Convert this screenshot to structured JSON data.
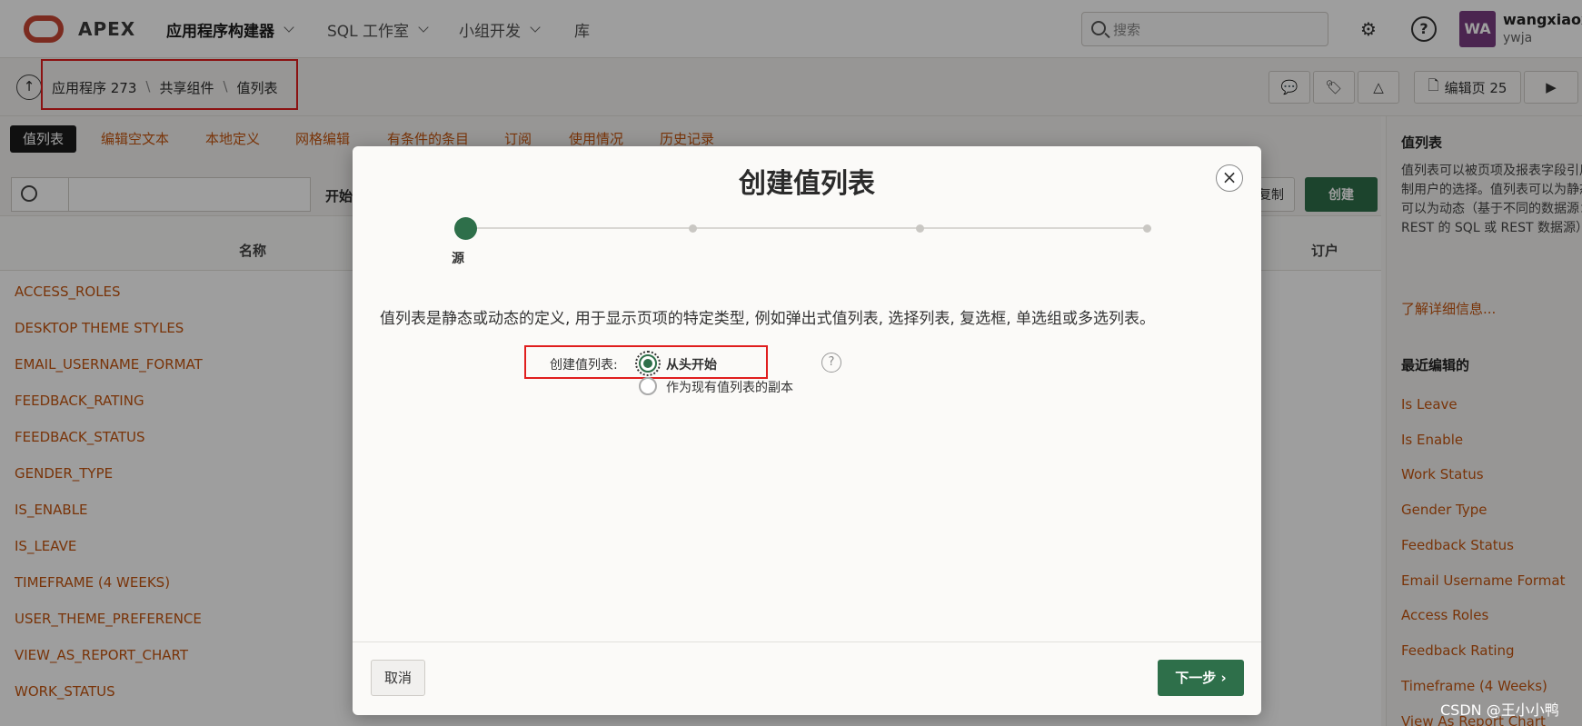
{
  "topbar": {
    "brand": "APEX",
    "nav": [
      "应用程序构建器",
      "SQL 工作室",
      "小组开发",
      "库"
    ],
    "search_placeholder": "搜索",
    "avatar_initials": "WA",
    "username": "wangxiaoxia",
    "workspace": "ywja"
  },
  "breadcrumb": {
    "items": [
      "应用程序 273",
      "共享组件",
      "值列表"
    ],
    "separator": "\\"
  },
  "toolbar": {
    "edit_page_label": "编辑页 25"
  },
  "tabs": [
    "值列表",
    "编辑空文本",
    "本地定义",
    "网格编辑",
    "有条件的条目",
    "订阅",
    "使用情况",
    "历史记录"
  ],
  "list": {
    "start_label": "开始",
    "copy_label": "复制",
    "create_label": "创建",
    "columns": [
      "名称",
      "订户"
    ],
    "rows": [
      "ACCESS_ROLES",
      "DESKTOP THEME STYLES",
      "EMAIL_USERNAME_FORMAT",
      "FEEDBACK_RATING",
      "FEEDBACK_STATUS",
      "GENDER_TYPE",
      "IS_ENABLE",
      "IS_LEAVE",
      "TIMEFRAME (4 WEEKS)",
      "USER_THEME_PREFERENCE",
      "VIEW_AS_REPORT_CHART",
      "WORK_STATUS"
    ]
  },
  "right_panel": {
    "title": "值列表",
    "description": "值列表可以被页项及报表字段引用。它控制显示的值并限制用户的选择。值列表可以为静态（基于您输入的值），也可以为动态（基于不同的数据源：本地数据库、启用 REST 的 SQL 或 REST 数据源）。",
    "learn_more": "了解详细信息...",
    "recent_title": "最近编辑的",
    "recent_items": [
      "Is Leave",
      "Is Enable",
      "Work Status",
      "Gender Type",
      "Feedback Status",
      "Email Username Format",
      "Access Roles",
      "Feedback Rating",
      "Timeframe (4 Weeks)",
      "View As Report Chart"
    ]
  },
  "dialog": {
    "title": "创建值列表",
    "step_label": "源",
    "description": "值列表是静态或动态的定义, 用于显示页项的特定类型, 例如弹出式值列表, 选择列表, 复选框, 单选组或多选列表。",
    "field_label": "创建值列表:",
    "options": [
      "从头开始",
      "作为现有值列表的副本"
    ],
    "selected_option": "从头开始",
    "cancel_label": "取消",
    "next_label": "下一步"
  },
  "watermark": "CSDN @王小小鸭",
  "colors": {
    "accent_green": "#2e6f4a",
    "link_orange": "#c4550f",
    "brand_red": "#c74634",
    "highlight_red": "#e01e1e"
  }
}
